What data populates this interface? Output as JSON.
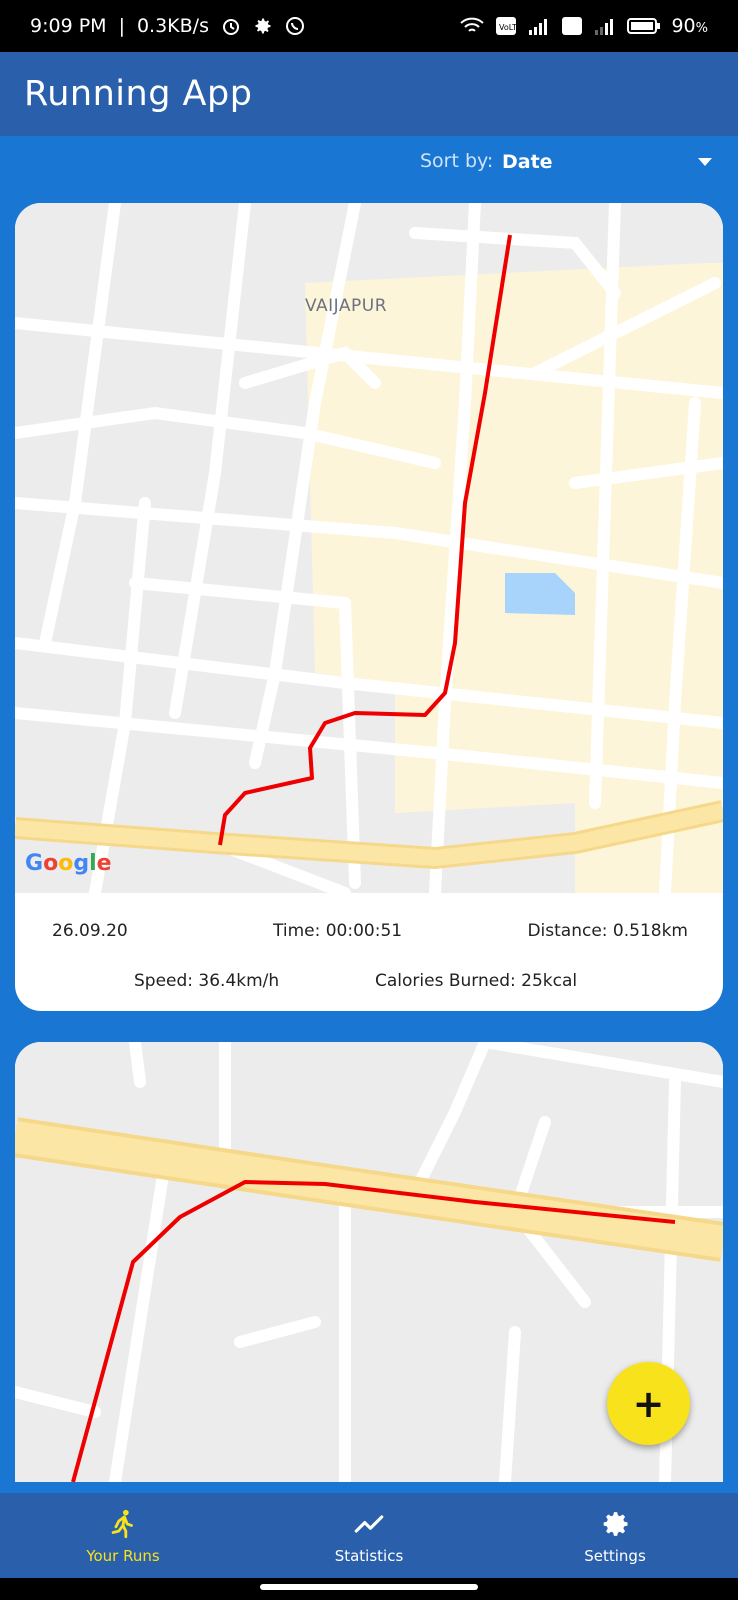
{
  "status_bar": {
    "time": "9:09 PM",
    "net_speed": "0.3KB/s",
    "battery": "90",
    "battery_unit": "%",
    "icons": [
      "alarm-icon",
      "gear-icon",
      "whatsapp-icon",
      "wifi-icon",
      "volte-icon",
      "signal-icon",
      "battery-icon"
    ]
  },
  "app_bar": {
    "title": "Running App"
  },
  "sort": {
    "label": "Sort by:",
    "value": "Date"
  },
  "runs": [
    {
      "map_label": "VAIJAPUR",
      "date": "26.09.20",
      "time": "Time: 00:00:51",
      "distance": "Distance: 0.518km",
      "speed": "Speed: 36.4km/h",
      "calories": "Calories Burned: 25kcal"
    },
    {}
  ],
  "map_attribution": [
    "G",
    "o",
    "o",
    "g",
    "l",
    "e"
  ],
  "fab": {
    "icon": "plus-icon",
    "label": "+"
  },
  "bottom_nav": [
    {
      "label": "Your Runs",
      "icon": "runner-icon",
      "active": true
    },
    {
      "label": "Statistics",
      "icon": "trend-line-icon",
      "active": false
    },
    {
      "label": "Settings",
      "icon": "gear-icon",
      "active": false
    }
  ],
  "colors": {
    "primary": "#2a5fab",
    "background": "#1976d2",
    "accent": "#f7e21c",
    "route": "#ee0000"
  }
}
